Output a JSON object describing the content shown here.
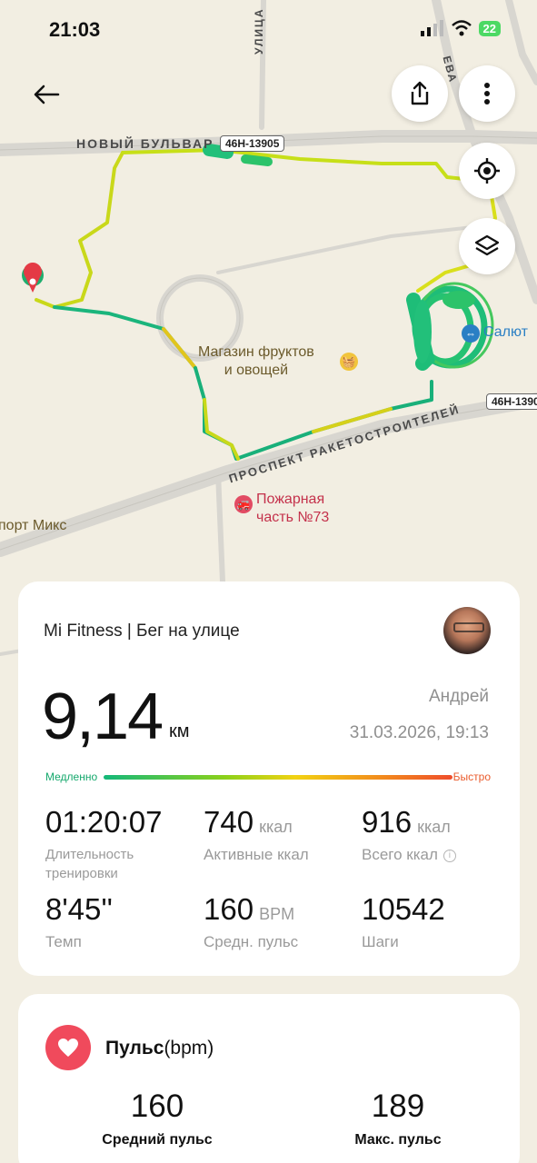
{
  "status_bar": {
    "time": "21:03",
    "battery": "22"
  },
  "map": {
    "streets": {
      "novy_bulvar": "НОВЫЙ БУЛЬВАР",
      "raketostroiteley": "ПРОСПЕКТ РАКЕТОСТРОИТЕЛЕЙ",
      "ulitsa": "УЛИЦА",
      "vertical_right": "ЕВА"
    },
    "road_badges": [
      "46Н-13905",
      "46Н-1390"
    ],
    "pois": {
      "fruit_shop_line1": "Магазин фруктов",
      "fruit_shop_line2": "и овощей",
      "fire_station_line1": "Пожарная",
      "fire_station_line2": "часть №73",
      "salyut": "Салют",
      "sport_mix": "порт Микс"
    }
  },
  "workout": {
    "app_and_type": "Mi Fitness | Бег на улице",
    "distance": "9,14",
    "distance_unit": "км",
    "user_name": "Андрей",
    "date_time": "31.03.2026, 19:13",
    "speed_scale": {
      "slow": "Медленно",
      "fast": "Быстро"
    },
    "metrics": {
      "duration": {
        "value": "01:20:07",
        "label": "Длительность тренировки"
      },
      "active_kcal": {
        "value": "740",
        "unit": "ккал",
        "label": "Активные ккал"
      },
      "total_kcal": {
        "value": "916",
        "unit": "ккал",
        "label": "Всего ккал"
      },
      "pace": {
        "value": "8'45''",
        "label": "Темп"
      },
      "avg_hr": {
        "value": "160",
        "unit": "BPM",
        "label": "Средн. пульс"
      },
      "steps": {
        "value": "10542",
        "label": "Шаги"
      }
    }
  },
  "heart_rate": {
    "title": "Пульс",
    "unit": "(bpm)",
    "avg": {
      "value": "160",
      "label": "Средний пульс"
    },
    "max": {
      "value": "189",
      "label": "Макс. пульс"
    }
  },
  "colors": {
    "accent_red": "#f04a5c",
    "route_green": "#14b87a",
    "route_yellow": "#e8e21a"
  }
}
